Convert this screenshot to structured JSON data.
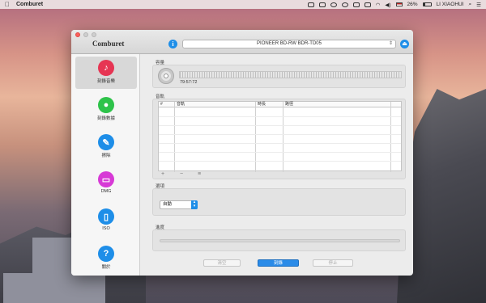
{
  "menubar": {
    "app_name": "Comburet",
    "battery": "26%",
    "user": "LI XIAOHUI"
  },
  "window": {
    "logo": "Comburet",
    "device": "PIONEER BD-RW BDR-TD05"
  },
  "sidebar": {
    "items": [
      {
        "label": "刻錄音樂",
        "icon": "music-note-icon",
        "color": "#e63553",
        "glyph": "♪"
      },
      {
        "label": "刻錄數據",
        "icon": "data-drop-icon",
        "color": "#2ec34a",
        "glyph": "●"
      },
      {
        "label": "擦除",
        "icon": "eraser-icon",
        "color": "#1e8ee8",
        "glyph": "✎"
      },
      {
        "label": "DMG",
        "icon": "dmg-disk-icon",
        "color": "#d73ad6",
        "glyph": "▭"
      },
      {
        "label": "ISO",
        "icon": "iso-bin-icon",
        "color": "#1e8ee8",
        "glyph": "▯"
      },
      {
        "label": "關於",
        "icon": "question-icon",
        "color": "#1e8ee8",
        "glyph": "?"
      }
    ]
  },
  "capacity": {
    "label": "容量",
    "time": "79:57:72"
  },
  "tracks": {
    "label": "音軌",
    "columns": [
      "#",
      "音軌",
      "時長",
      "路徑"
    ],
    "add": "+",
    "remove": "−",
    "list": "≡"
  },
  "options": {
    "label": "選項",
    "mode": "自動"
  },
  "progress": {
    "label": "進度",
    "value": 0
  },
  "buttons": {
    "clear": "清空",
    "burn": "刻錄",
    "stop": "停止"
  }
}
